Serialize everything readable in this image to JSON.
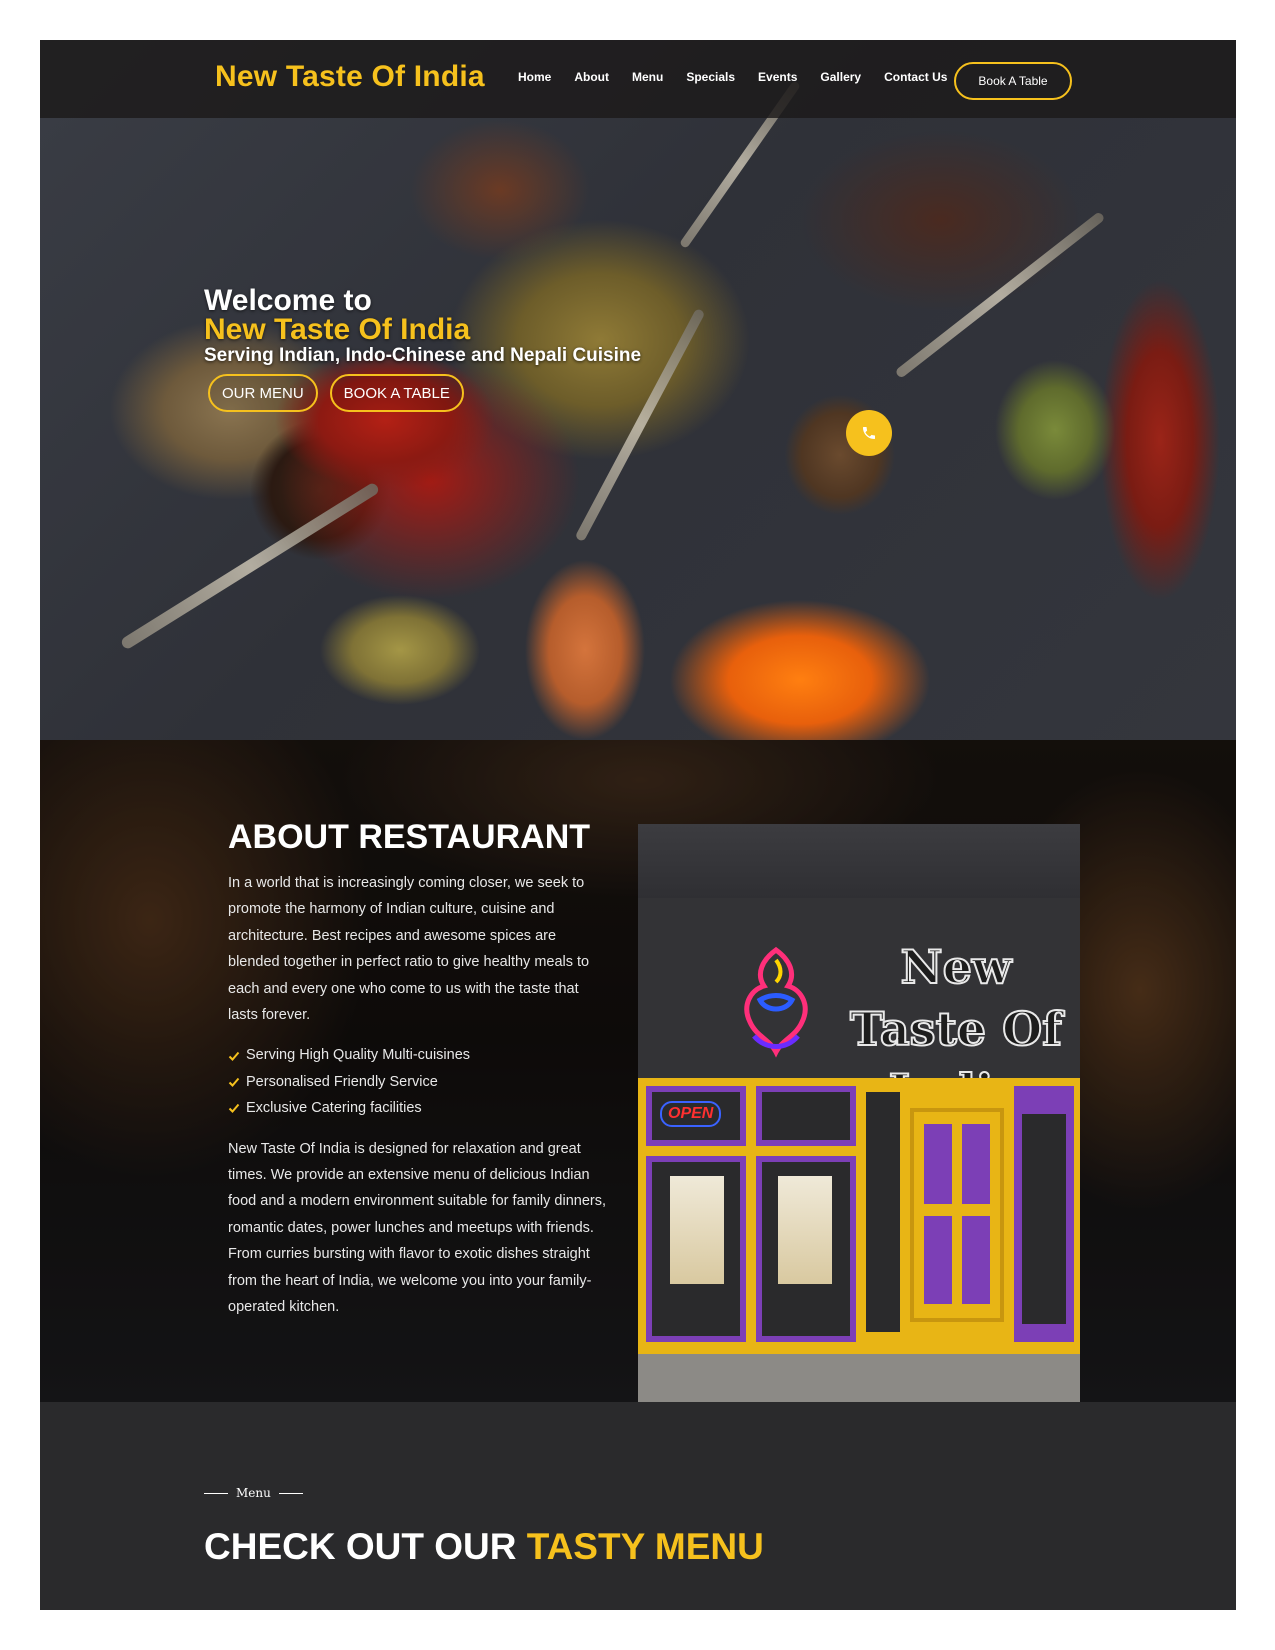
{
  "brand": {
    "name": "New Taste Of India",
    "accent_color": "#f6c11d"
  },
  "nav": {
    "items": [
      "Home",
      "About",
      "Menu",
      "Specials",
      "Events",
      "Gallery",
      "Contact Us"
    ],
    "book_label": "Book A Table"
  },
  "hero": {
    "welcome": "Welcome to",
    "name": "New Taste Of India",
    "subtitle": "Serving Indian, Indo-Chinese and Nepali Cuisine",
    "btn_menu": "OUR MENU",
    "btn_book": "BOOK A TABLE",
    "phone_icon": "phone-icon"
  },
  "about": {
    "title": "ABOUT RESTAURANT",
    "para1": "In a world that is increasingly coming closer, we seek to promote the harmony of Indian culture, cuisine and architecture. Best recipes and awesome spices are blended together in perfect ratio to give healthy meals to each and every one who come to us with the taste that lasts forever.",
    "features": [
      "Serving High Quality Multi-cuisines",
      "Personalised Friendly Service",
      "Exclusive Catering facilities"
    ],
    "para2": "New Taste Of India is designed for relaxation and great times. We provide an extensive menu of delicious Indian food and a modern environment suitable for family dinners, romantic dates, power lunches and meetups with friends. From curries bursting with flavor to exotic dishes straight from the heart of India, we welcome you into your family-operated kitchen.",
    "storefront_sign": "New Taste Of India",
    "storefront_open": "OPEN"
  },
  "menu_section": {
    "kicker": "Menu",
    "heading_main": "CHECK OUT OUR ",
    "heading_accent": "TASTY MENU"
  }
}
